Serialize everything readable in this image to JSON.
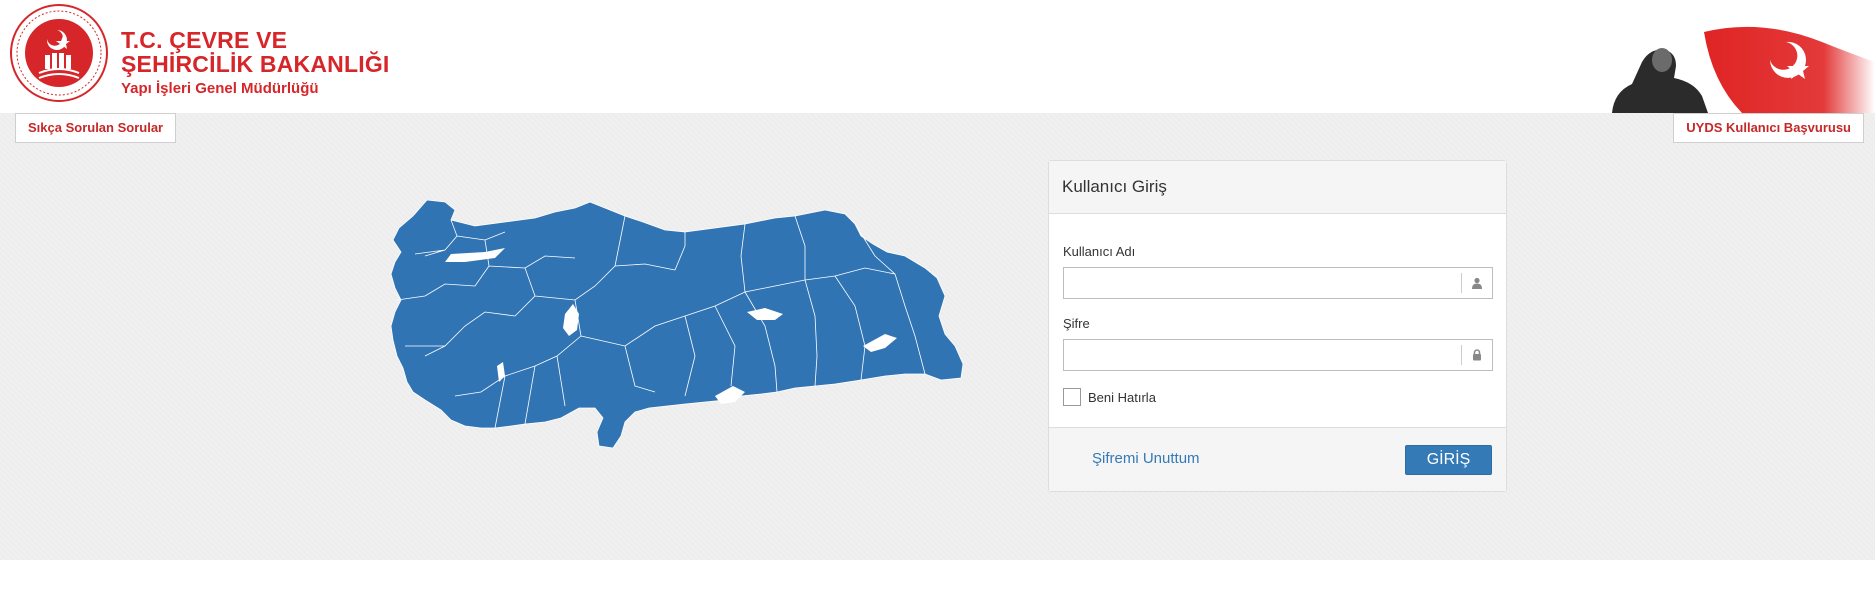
{
  "header": {
    "ministry_line1": "T.C. ÇEVRE VE",
    "ministry_line2": "ŞEHİRCİLİK BAKANLIĞI",
    "directorate": "Yapı İşleri Genel Müdürlüğü"
  },
  "nav": {
    "faq_label": "Sıkça Sorulan Sorular",
    "apply_label": "UYDS Kullanıcı Başvurusu"
  },
  "login": {
    "title": "Kullanıcı Giriş",
    "username_label": "Kullanıcı Adı",
    "username_value": "",
    "password_label": "Şifre",
    "password_value": "",
    "remember_label": "Beni Hatırla",
    "remember_checked": false,
    "forgot_label": "Şifremi Unuttum",
    "submit_label": "GİRİŞ"
  },
  "colors": {
    "brand_red": "#d6262a",
    "map_blue": "#3174b4",
    "button_blue": "#337ab7",
    "band_bg": "#f0f0f0"
  },
  "icons": {
    "username_addon": "user-icon",
    "password_addon": "lock-icon"
  }
}
